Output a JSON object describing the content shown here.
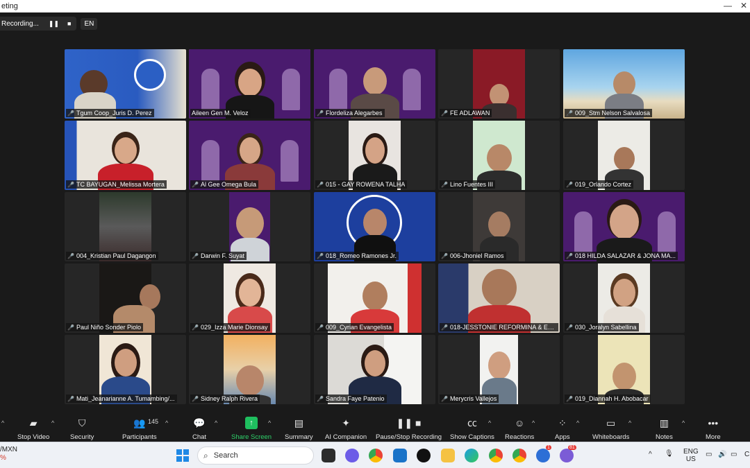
{
  "window": {
    "title": "eting",
    "minimize": "—",
    "close": "✕"
  },
  "recording": {
    "label": "Recording...",
    "pause": "❚❚",
    "stop": "■",
    "language": "EN"
  },
  "participants_grid": [
    {
      "name": "Tgum Coop_Juris D. Perez",
      "active": false
    },
    {
      "name": "Aileen Gen M. Veloz",
      "active": true
    },
    {
      "name": "Flordeliza Alegarbes",
      "active": false
    },
    {
      "name": "FE ADLAWAN",
      "active": false
    },
    {
      "name": "009_Stm Nelson Salvalosa",
      "active": false
    },
    {
      "name": "TC BAYUGAN_Melissa Mortera",
      "active": false
    },
    {
      "name": "Al Gee Omega Bula",
      "active": false
    },
    {
      "name": "015 -  GAY ROWENA TALHA",
      "active": false
    },
    {
      "name": "Lino Fuentes III",
      "active": false
    },
    {
      "name": "019_Orlando Cortez",
      "active": false
    },
    {
      "name": "004_Kristian Paul Dagangon",
      "active": false
    },
    {
      "name": "Darwin F. Suyat",
      "active": false
    },
    {
      "name": "018_Romeo Ramones Jr.",
      "active": false
    },
    {
      "name": "006-Jhoniel Ramos",
      "active": false
    },
    {
      "name": "018 HILDA SALAZAR & JONA MA...",
      "active": false
    },
    {
      "name": "Paul Niño Sonder Piolo",
      "active": false
    },
    {
      "name": "029_Izza Marie Dionsay",
      "active": false
    },
    {
      "name": "009_Cyrian Evangelista",
      "active": false
    },
    {
      "name": "018-JESSTONIE REFORMINA & ER...",
      "active": false
    },
    {
      "name": "030_Joralyn Sabellina",
      "active": false
    },
    {
      "name": "Mati_Jeanarianne A. Tumambing/...",
      "active": false
    },
    {
      "name": "Sidney Ralph Rivera",
      "active": false
    },
    {
      "name": "Sandra Faye Patenio",
      "active": false
    },
    {
      "name": "Merycris Vallejos",
      "active": false
    },
    {
      "name": "019_Diannah H. Abobacar",
      "active": false
    }
  ],
  "toolbar": {
    "stop_video": "Stop Video",
    "security": "Security",
    "participants": "Participants",
    "participants_count": "145",
    "chat": "Chat",
    "share_screen": "Share Screen",
    "summary": "Summary",
    "ai_companion": "AI Companion",
    "pause_stop_recording": "Pause/Stop Recording",
    "show_captions": "Show Captions",
    "reactions": "Reactions",
    "apps": "Apps",
    "whiteboards": "Whiteboards",
    "notes": "Notes",
    "more": "More"
  },
  "taskbar": {
    "ticker_symbol": "/MXN",
    "ticker_change": "%",
    "search_label": "Search",
    "lang_top": "ENG",
    "lang_bottom": "US",
    "badge_outlook": "1",
    "badge_teams": "81",
    "edge_char": "C"
  },
  "colors": {
    "active_speaker_outline": "#d9e44a",
    "share_green": "#1fbf5f",
    "muted_red": "#e74a4a",
    "purple_background": "#4a1b6e"
  }
}
